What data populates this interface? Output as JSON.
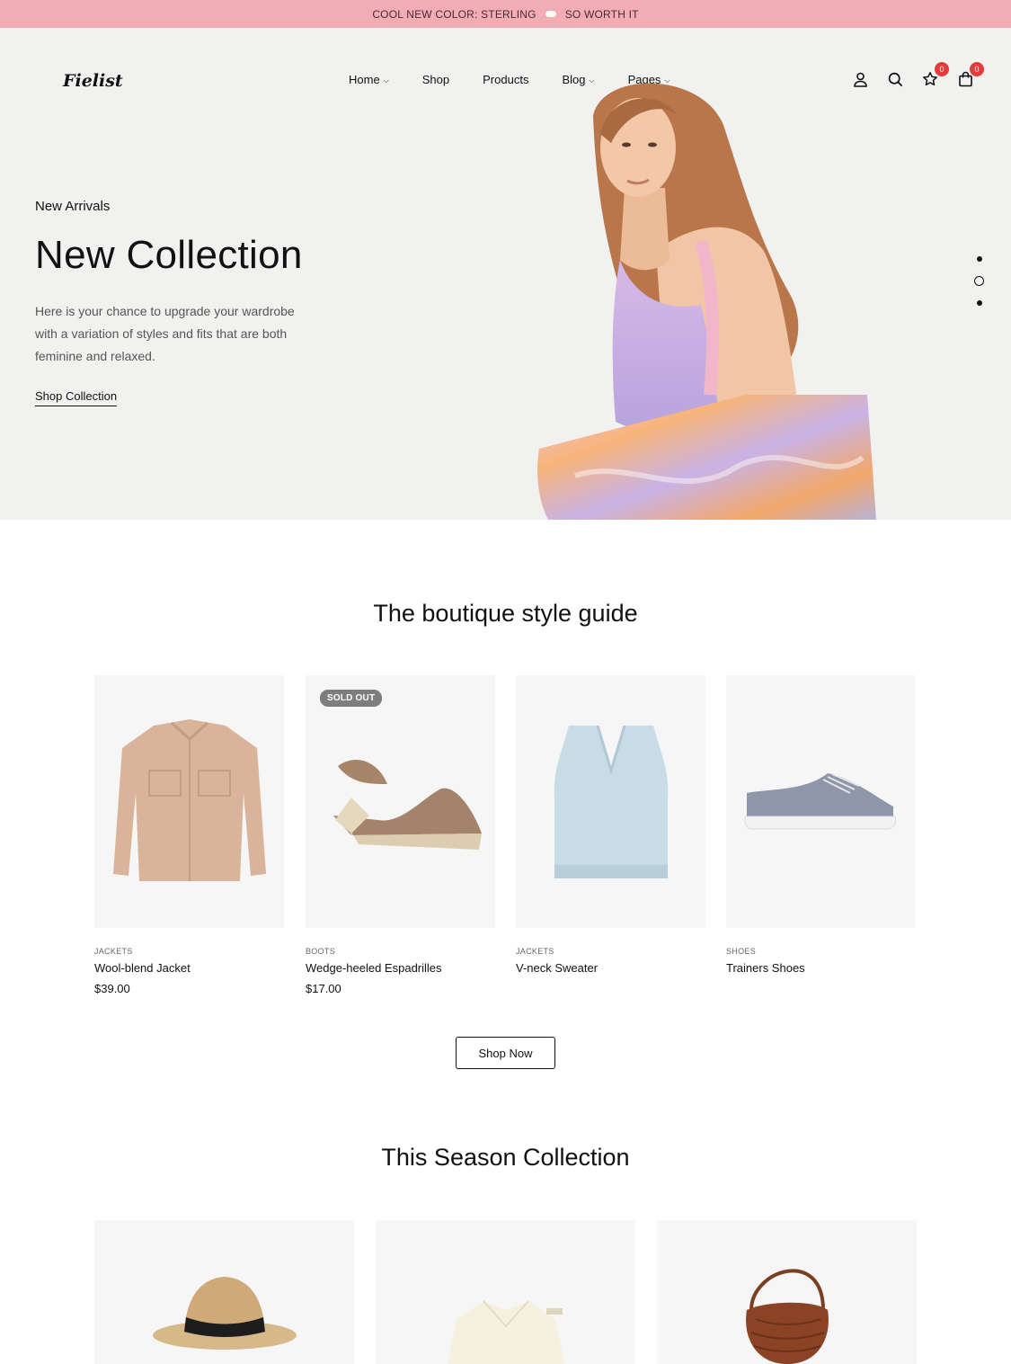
{
  "announcement": {
    "left": "COOL NEW COLOR: STERLING",
    "right": "SO WORTH IT"
  },
  "brand": {
    "logo": "Fielist"
  },
  "nav": [
    {
      "label": "Home",
      "has_dropdown": true
    },
    {
      "label": "Shop",
      "has_dropdown": false
    },
    {
      "label": "Products",
      "has_dropdown": false
    },
    {
      "label": "Blog",
      "has_dropdown": true
    },
    {
      "label": "Pages",
      "has_dropdown": true
    }
  ],
  "header_icons": {
    "account": "user-icon",
    "search": "search-icon",
    "wishlist": "star-icon",
    "cart": "bag-icon",
    "wishlist_count": "0",
    "cart_count": "0"
  },
  "hero": {
    "eyebrow": "New Arrivals",
    "title": "New Collection",
    "description": "Here is your chance to upgrade your wardrobe with a variation of styles and fits that are both feminine and relaxed.",
    "link": "Shop Collection",
    "slide_count": 3,
    "active_slide": 2
  },
  "style_guide": {
    "title": "The boutique style guide",
    "products": [
      {
        "category": "JACKETS",
        "name": "Wool-blend Jacket",
        "price": "$39.00",
        "badge": ""
      },
      {
        "category": "BOOTS",
        "name": "Wedge-heeled Espadrilles",
        "price": "$17.00",
        "badge": "SOLD OUT"
      },
      {
        "category": "JACKETS",
        "name": "V-neck Sweater",
        "price": "",
        "badge": ""
      },
      {
        "category": "SHOES",
        "name": "Trainers Shoes",
        "price": "",
        "badge": ""
      }
    ],
    "button": "Shop Now"
  },
  "season": {
    "title": "This Season Collection"
  },
  "colors": {
    "announcement_bg": "#f2acb6",
    "hero_bg": "#f1f1f0",
    "badge": "#e63b3b"
  }
}
